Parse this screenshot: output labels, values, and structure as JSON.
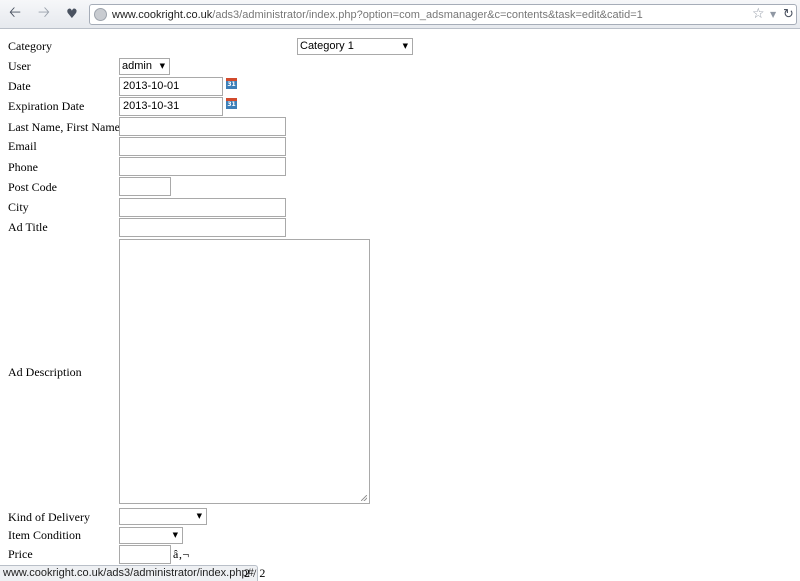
{
  "browser": {
    "url_host": "www.cookright.co.uk",
    "url_path": "/ads3/administrator/index.php?option=com_adsmanager&c=contents&task=edit&catid=1",
    "back_icon": "back-arrow-icon",
    "forward_icon": "forward-arrow-icon",
    "history_icon": "history-icon",
    "star_icon": "bookmark-star-icon",
    "reload_icon": "reload-icon"
  },
  "form": {
    "category": {
      "label": "Category",
      "value": "Category 1"
    },
    "user": {
      "label": "User",
      "value": "admin"
    },
    "date": {
      "label": "Date",
      "value": "2013-10-01"
    },
    "expiration_date": {
      "label": "Expiration Date",
      "value": "2013-10-31"
    },
    "name": {
      "label": "Last Name, First Name",
      "value": ""
    },
    "email": {
      "label": "Email",
      "value": ""
    },
    "phone": {
      "label": "Phone",
      "value": ""
    },
    "post_code": {
      "label": "Post Code",
      "value": ""
    },
    "city": {
      "label": "City",
      "value": ""
    },
    "ad_title": {
      "label": "Ad Title",
      "value": ""
    },
    "ad_description": {
      "label": "Ad Description",
      "value": ""
    },
    "kind_of_delivery": {
      "label": "Kind of Delivery",
      "value": ""
    },
    "item_condition": {
      "label": "Item Condition",
      "value": ""
    },
    "price": {
      "label": "Price",
      "value": "",
      "currency_text": "â‚¬"
    },
    "calendar_icon_text": "31"
  },
  "status": {
    "url": "www.cookright.co.uk/ads3/administrator/index.php#",
    "page_indicator": "2 / 2"
  }
}
